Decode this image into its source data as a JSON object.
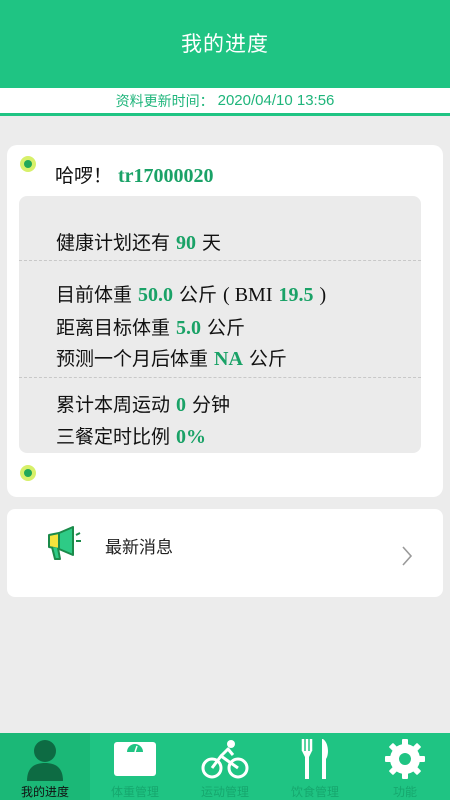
{
  "header": {
    "title": "我的进度"
  },
  "update_bar": {
    "label": "资料更新时间：",
    "time": "2020/04/10 13:56"
  },
  "greeting": {
    "hello": "哈啰！",
    "username": "tr17000020"
  },
  "plan": {
    "prefix": "健康计划还有",
    "days": "90",
    "unit": "天"
  },
  "weight": {
    "current_prefix": "目前体重",
    "current_value": "50.0",
    "current_unit": "公斤",
    "bmi_open": "( BMI",
    "bmi_value": "19.5",
    "bmi_close": ")",
    "target_prefix": "距离目标体重",
    "target_value": "5.0",
    "target_unit": "公斤",
    "predict_prefix": "预测一个月后体重",
    "predict_value": "NA",
    "predict_unit": "公斤"
  },
  "activity": {
    "exercise_prefix": "累计本周运动",
    "exercise_value": "0",
    "exercise_unit": "分钟",
    "meals_prefix": "三餐定时比例",
    "meals_value": "0%"
  },
  "news": {
    "label": "最新消息",
    "icon": "megaphone-icon"
  },
  "tabs": [
    {
      "label": "我的进度",
      "icon": "person-icon",
      "active": true
    },
    {
      "label": "体重管理",
      "icon": "scale-icon",
      "active": false
    },
    {
      "label": "运动管理",
      "icon": "cyclist-icon",
      "active": false
    },
    {
      "label": "饮食管理",
      "icon": "fork-knife-icon",
      "active": false
    },
    {
      "label": "功能",
      "icon": "gear-icon",
      "active": false
    }
  ],
  "colors": {
    "primary": "#1fc483",
    "accent_text": "#1aa267",
    "background": "#ececec"
  }
}
